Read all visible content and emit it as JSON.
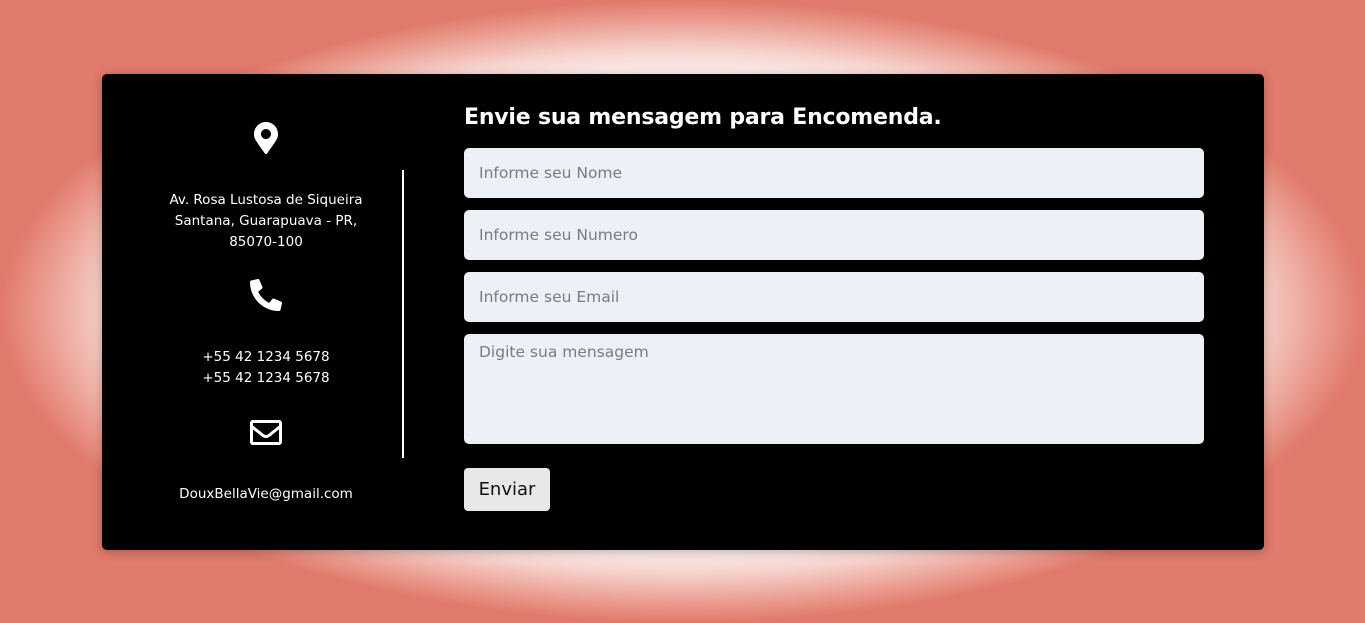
{
  "contact": {
    "address_lines": [
      "Av. Rosa Lustosa de Siqueira",
      "Santana, Guarapuava - PR,",
      "85070-100"
    ],
    "phones": [
      "+55 42 1234 5678",
      "+55 42 1234 5678"
    ],
    "email": "DouxBellaVie@gmail.com",
    "icons": [
      "location-pin-icon",
      "phone-icon",
      "envelope-icon"
    ]
  },
  "form": {
    "title": "Envie sua mensagem para Encomenda.",
    "name_placeholder": "Informe seu Nome",
    "number_placeholder": "Informe seu Numero",
    "email_placeholder": "Informe seu Email",
    "message_placeholder": "Digite sua mensagem",
    "submit_label": "Enviar"
  },
  "colors": {
    "card_background": "#000000",
    "field_background": "#eef0f8",
    "button_background": "#e8e8e8",
    "page_edge": "#e07a6b"
  }
}
